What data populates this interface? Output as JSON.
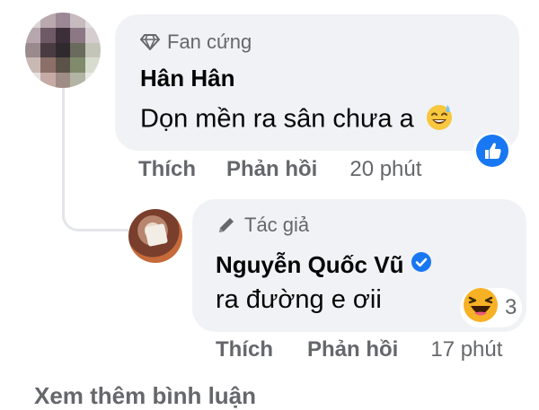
{
  "comment": {
    "badge": "Fan cứng",
    "author": "Hân Hân",
    "text": "Dọn mền ra sân chưa a",
    "actions": {
      "like": "Thích",
      "reply": "Phản hồi",
      "time": "20 phút"
    },
    "reaction": {
      "type": "like"
    }
  },
  "reply": {
    "badge": "Tác giả",
    "author": "Nguyễn Quốc Vũ",
    "verified": true,
    "text": "ra đường e ơii",
    "reaction": {
      "type": "haha",
      "count": "3"
    },
    "actions": {
      "like": "Thích",
      "reply": "Phản hồi",
      "time": "17 phút"
    }
  },
  "footer": {
    "see_more": "Xem thêm bình luận"
  },
  "colors": {
    "bubble": "#f0f2f5",
    "secondary_text": "#65676b",
    "like_blue": "#1877f2",
    "haha_yellow": "#f7b125"
  }
}
